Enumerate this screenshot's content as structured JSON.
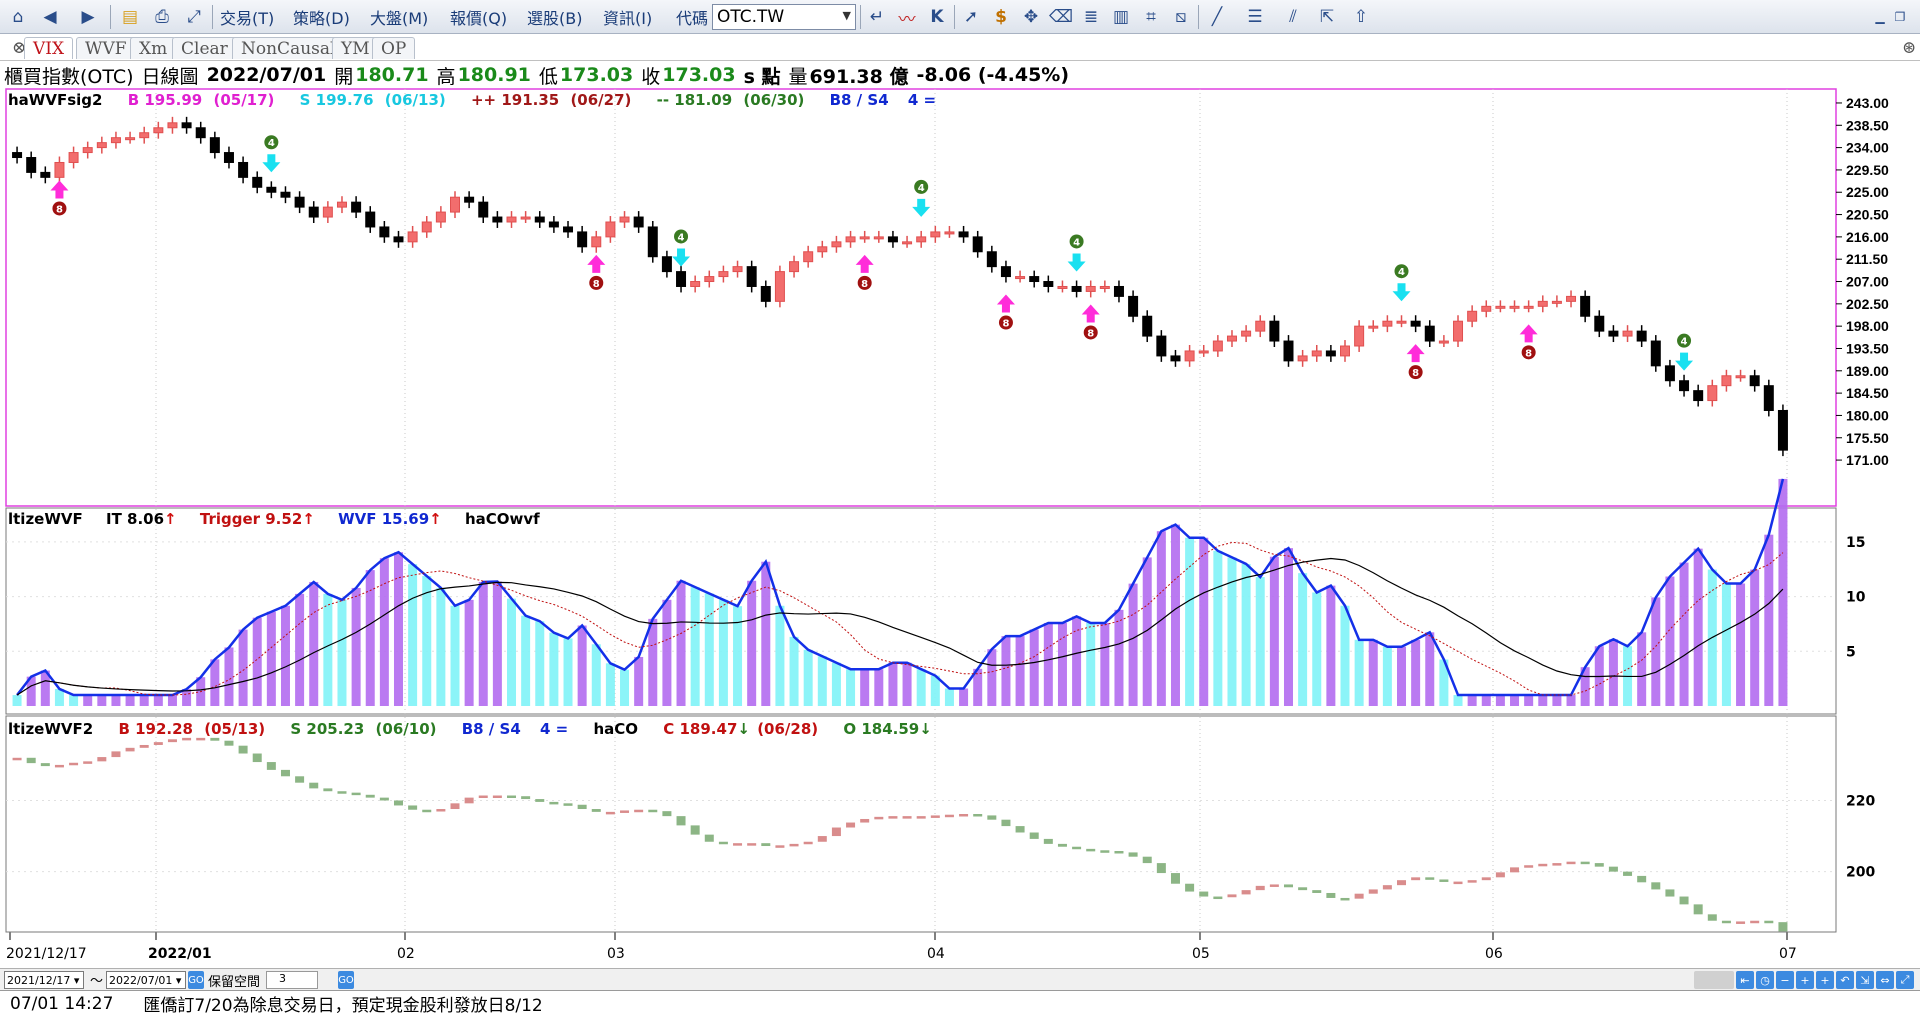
{
  "toolbar": {
    "menus": [
      "交易(T)",
      "策略(D)",
      "大盤(M)",
      "報價(Q)",
      "選股(B)",
      "資訊(I)"
    ],
    "code_label": "代碼",
    "symbol": "OTC.TW"
  },
  "tabs": [
    "VIX",
    "WVF",
    "Xm",
    "Clear",
    "NonCausal",
    "YM",
    "OP"
  ],
  "info": {
    "name": "櫃買指數(OTC)",
    "period": "日線圖",
    "date": "2022/07/01",
    "open_label": "開",
    "open": "180.71",
    "high_label": "高",
    "high": "180.91",
    "low_label": "低",
    "low": "173.03",
    "close_label": "收",
    "close": "173.03",
    "unit": "s 點",
    "volume_label": "量",
    "volume": "691.38 億",
    "change": "-8.06 (-4.45%)"
  },
  "pane1": {
    "name": "haWVFsig2",
    "b": "B 195.99",
    "b_date": "(05/17)",
    "s": "S 199.76",
    "s_date": "(06/13)",
    "pp": "++ 191.35",
    "pp_date": "(06/27)",
    "mm": "-- 181.09",
    "mm_date": "(06/30)",
    "bs": "B8 / S4",
    "four": "4 ="
  },
  "pane2": {
    "name": "ltizeWVF",
    "it": "IT 8.06",
    "trigger": "Trigger 9.52",
    "wvf": "WVF 15.69",
    "haco": "haCOwvf"
  },
  "pane3": {
    "name": "ltizeWVF2",
    "b": "B 192.28",
    "b_date": "(05/13)",
    "s": "S 205.23",
    "s_date": "(06/10)",
    "bs": "B8 / S4",
    "four": "4 =",
    "haco": "haCO",
    "c": "C 189.47",
    "c_date": "(06/28)",
    "o": "O 184.59"
  },
  "colors": {
    "up": "#f26d6d",
    "down": "#000000",
    "magenta_arrow": "#ff2cd9",
    "cyan_arrow": "#19e0f0",
    "wvf_line": "#1430e8",
    "wvf_up_bar": "#b36bf0",
    "wvf_dn_bar": "#7ff3f7",
    "haco_up": "#d98c8c",
    "haco_dn": "#8cb585",
    "green_circle": "#3a7a22",
    "red_circle": "#a01010"
  },
  "chart_data": {
    "type": "candlestick",
    "ylim": [
      169,
      244
    ],
    "yticks": [
      "243.00",
      "238.50",
      "234.00",
      "229.50",
      "225.00",
      "220.50",
      "216.00",
      "211.50",
      "207.00",
      "202.50",
      "198.00",
      "193.50",
      "189.00",
      "184.50",
      "180.00",
      "175.50",
      "171.00"
    ],
    "xtick_labels": [
      "2021/12/17",
      "2022/01",
      "02",
      "03",
      "04",
      "05",
      "06",
      "07"
    ],
    "closes": [
      232,
      229,
      228,
      231,
      233,
      234,
      235,
      236,
      236,
      237,
      238,
      239,
      238,
      236,
      233,
      231,
      228,
      226,
      225,
      224,
      222,
      220,
      222,
      223,
      221,
      218,
      216,
      215,
      217,
      219,
      221,
      224,
      223,
      220,
      219,
      220,
      220,
      219,
      218,
      217,
      214,
      216,
      219,
      220,
      218,
      212,
      209,
      206,
      207,
      208,
      209,
      210,
      206,
      203,
      209,
      211,
      213,
      214,
      215,
      216,
      216,
      216,
      215,
      215,
      216,
      217,
      217,
      216,
      213,
      210,
      208,
      208,
      207,
      206,
      206,
      205,
      206,
      206,
      204,
      200,
      196,
      192,
      191,
      193,
      193,
      195,
      196,
      197,
      199,
      195,
      191,
      192,
      193,
      192,
      194,
      198,
      198,
      199,
      199,
      198,
      195,
      195,
      199,
      201,
      202,
      202,
      202,
      202,
      203,
      203,
      204,
      200,
      197,
      196,
      197,
      195,
      190,
      187,
      185,
      183,
      186,
      188,
      188,
      186,
      181,
      173
    ],
    "wvf_yticks": [
      "15",
      "10",
      "5"
    ],
    "haco_yticks": [
      "220",
      "200"
    ]
  }
}
